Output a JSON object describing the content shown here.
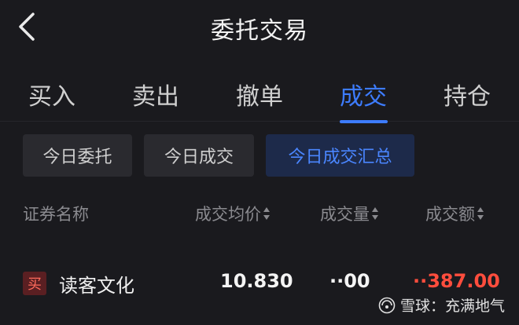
{
  "header": {
    "title": "委托交易",
    "back_icon": "chevron-left-icon"
  },
  "tabs": [
    {
      "label": "买入"
    },
    {
      "label": "卖出"
    },
    {
      "label": "撤单"
    },
    {
      "label": "成交",
      "active": true
    },
    {
      "label": "持仓"
    }
  ],
  "subtabs": [
    {
      "label": "今日委托"
    },
    {
      "label": "今日成交"
    },
    {
      "label": "今日成交汇总",
      "active": true
    }
  ],
  "columns": {
    "name": "证券名称",
    "avg_price": "成交均价",
    "quantity": "成交量",
    "amount": "成交额"
  },
  "rows": [
    {
      "side": "买",
      "name": "读客文化",
      "avg_price": "10.830",
      "quantity": "··00",
      "amount": "··387.00"
    }
  ],
  "watermark": {
    "text": "雪球：充满地气",
    "logo_icon": "snowball-logo-icon"
  },
  "colors": {
    "accent": "#3d7cff",
    "buy_red": "#ff4d3d",
    "background": "#1a1a1e"
  }
}
